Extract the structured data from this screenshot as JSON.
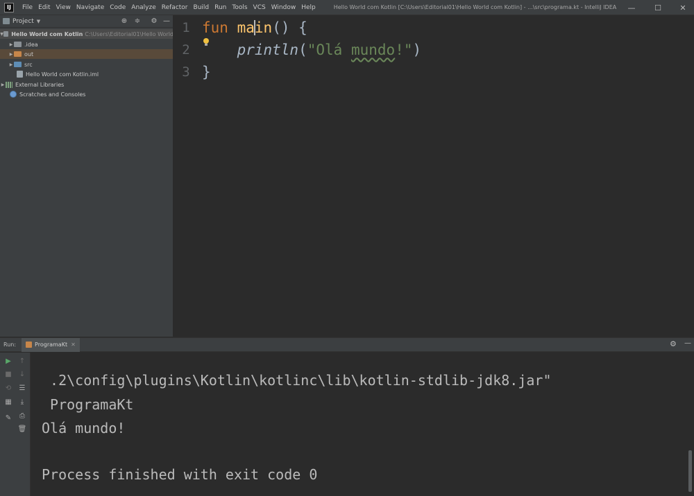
{
  "app": {
    "logo_text": "IJ",
    "menu": [
      "File",
      "Edit",
      "View",
      "Navigate",
      "Code",
      "Analyze",
      "Refactor",
      "Build",
      "Run",
      "Tools",
      "VCS",
      "Window",
      "Help"
    ],
    "window_title": "Hello World com Kotlin [C:\\Users\\Editorial01\\Hello World com Kotlin] - ...\\src\\programa.kt - IntelliJ IDEA",
    "controls": {
      "minimize": "—",
      "maximize": "☐",
      "close": "✕"
    }
  },
  "project_panel": {
    "title": "Project",
    "tree": {
      "root": {
        "name": "Hello World com Kotlin",
        "path": "C:\\Users\\Editorial01\\Hello World"
      },
      "idea": ".idea",
      "out": "out",
      "src": "src",
      "iml": "Hello World com Kotlin.iml",
      "external": "External Libraries",
      "scratches": "Scratches and Consoles"
    }
  },
  "editor": {
    "line_numbers": [
      "1",
      "2",
      "3"
    ],
    "line1": {
      "kw": "fun",
      "name_a": "ma",
      "name_b": "in",
      "rest": "() {"
    },
    "line2": {
      "call": "println",
      "open": "(",
      "str_a": "\"Olá ",
      "str_b": "mundo",
      "str_c": "!\"",
      "close": ")"
    },
    "line3": {
      "text": "}"
    }
  },
  "run_panel": {
    "label": "Run:",
    "tab": "ProgramaKt",
    "output": [
      " .2\\config\\plugins\\Kotlin\\kotlinc\\lib\\kotlin-stdlib-jdk8.jar\"",
      " ProgramaKt",
      "Olá mundo!",
      "",
      "Process finished with exit code 0"
    ]
  }
}
